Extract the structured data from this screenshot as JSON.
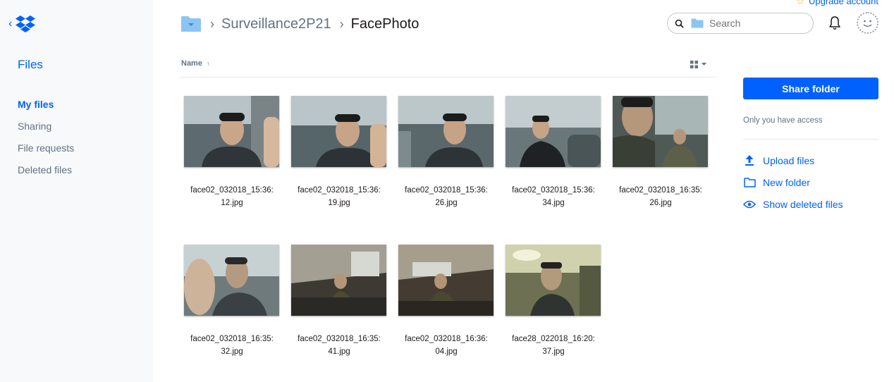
{
  "account": {
    "upgrade_label": "Upgrade account"
  },
  "sidebar": {
    "title": "Files",
    "items": [
      {
        "label": "My files",
        "active": true
      },
      {
        "label": "Sharing",
        "active": false
      },
      {
        "label": "File requests",
        "active": false
      },
      {
        "label": "Deleted files",
        "active": false
      }
    ]
  },
  "breadcrumb": {
    "parent": "Surveillance2P21",
    "current": "FacePhoto"
  },
  "search": {
    "placeholder": "Search"
  },
  "list_header": {
    "name_label": "Name",
    "sort": "ascending"
  },
  "files": [
    {
      "line1": "face02_032018_15:36:",
      "line2": "12.jpg"
    },
    {
      "line1": "face02_032018_15:36:",
      "line2": "19.jpg"
    },
    {
      "line1": "face02_032018_15:36:",
      "line2": "26.jpg"
    },
    {
      "line1": "face02_032018_15:36:",
      "line2": "34.jpg"
    },
    {
      "line1": "face02_032018_16:35:",
      "line2": "26.jpg"
    },
    {
      "line1": "face02_032018_16:35:",
      "line2": "32.jpg"
    },
    {
      "line1": "face02_032018_16:35:",
      "line2": "41.jpg"
    },
    {
      "line1": "face02_032018_16:36:",
      "line2": "04.jpg"
    },
    {
      "line1": "face28_022018_16:20:",
      "line2": "37.jpg"
    }
  ],
  "right_panel": {
    "share_label": "Share folder",
    "access_text": "Only you have access",
    "actions": [
      {
        "label": "Upload files",
        "icon": "upload-icon"
      },
      {
        "label": "New folder",
        "icon": "folder-icon"
      },
      {
        "label": "Show deleted files",
        "icon": "eye-icon"
      }
    ]
  },
  "colors": {
    "accent": "#0061fe",
    "sidebar_bg": "#f7f9fa",
    "muted_text": "#637282"
  }
}
